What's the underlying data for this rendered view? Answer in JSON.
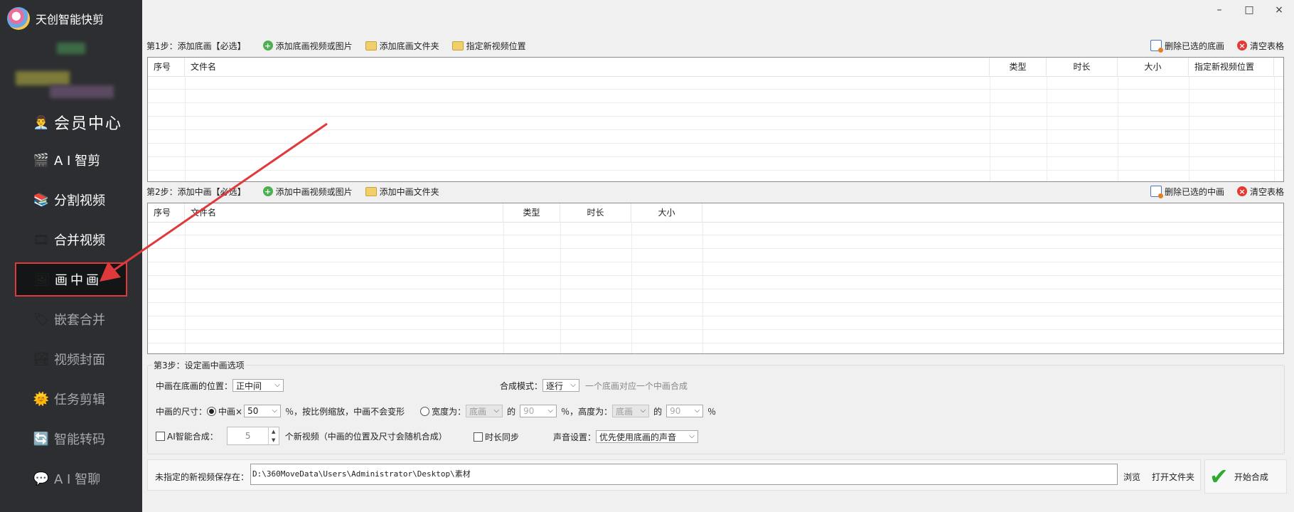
{
  "app": {
    "title": "天创智能快剪"
  },
  "window": {
    "minimize": "–",
    "maximize": "□",
    "close": "×"
  },
  "sidebar": {
    "items": [
      {
        "label": "会员中心",
        "icon": "member-icon"
      },
      {
        "label": "A I 智剪",
        "icon": "ai-cut-icon"
      },
      {
        "label": "分割视频",
        "icon": "split-video-icon"
      },
      {
        "label": "合并视频",
        "icon": "merge-video-icon"
      },
      {
        "label": "画中画",
        "icon": "picture-in-picture-icon"
      },
      {
        "label": "嵌套合并",
        "icon": "nested-merge-icon"
      },
      {
        "label": "视频封面",
        "icon": "video-cover-icon"
      },
      {
        "label": "任务剪辑",
        "icon": "task-edit-icon"
      },
      {
        "label": "智能转码",
        "icon": "smart-transcode-icon"
      },
      {
        "label": "A I 智聊",
        "icon": "ai-chat-icon"
      }
    ],
    "active": "画中画"
  },
  "step1": {
    "label": "第1步：添加底画【必选】",
    "add_media": "添加底画视频或图片",
    "add_folder": "添加底画文件夹",
    "set_location": "指定新视频位置",
    "delete_selected": "删除已选的底画",
    "clear_table": "清空表格",
    "columns": [
      "序号",
      "文件名",
      "类型",
      "时长",
      "大小",
      "指定新视频位置"
    ]
  },
  "step2": {
    "label": "第2步：添加中画【必选】",
    "add_media": "添加中画视频或图片",
    "add_folder": "添加中画文件夹",
    "delete_selected": "删除已选的中画",
    "clear_table": "清空表格",
    "columns": [
      "序号",
      "文件名",
      "类型",
      "时长",
      "大小"
    ]
  },
  "step3": {
    "title": "第3步：设定画中画选项",
    "position_label": "中画在底画的位置：",
    "position_value": "正中间",
    "compose_mode_label": "合成模式：",
    "compose_mode_value": "逐行",
    "compose_mode_hint": "一个底画对应一个中画合成",
    "size_label": "中画的尺寸：",
    "size_option1_prefix": "中画×",
    "size_scale_value": "50",
    "size_option1_suffix": "％，按比例缩放，中画不会变形",
    "width_label": "宽度为：",
    "width_base": "底画",
    "of1": "的",
    "width_percent": "90",
    "pct1": "％，",
    "height_label": "高度为：",
    "height_base": "底画",
    "of2": "的",
    "height_percent": "90",
    "pct2": "％",
    "ai_compose_label": "AI智能合成：",
    "ai_count": "5",
    "ai_hint": "个新视频（中画的位置及尺寸会随机合成）",
    "duration_sync": "时长同步",
    "audio_label": "声音设置：",
    "audio_value": "优先使用底画的声音"
  },
  "save": {
    "label": "未指定的新视频保存在：",
    "path": "D:\\360MoveData\\Users\\Administrator\\Desktop\\素材",
    "browse": "浏览",
    "open_folder": "打开文件夹",
    "start": "开始合成"
  }
}
